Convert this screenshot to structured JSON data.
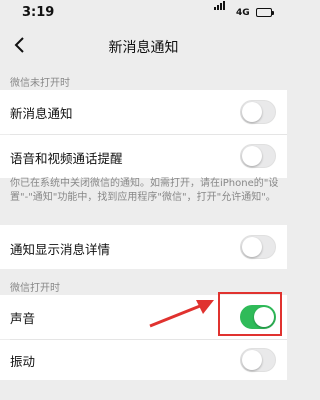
{
  "status_bar": {
    "time": "3:19",
    "network": "4G"
  },
  "nav": {
    "title": "新消息通知"
  },
  "sections": {
    "closed_header": "微信未打开时",
    "open_header": "微信打开时"
  },
  "rows": {
    "new_message": {
      "label": "新消息通知",
      "on": false
    },
    "voice_video": {
      "label": "语音和视频通话提醒",
      "on": false
    },
    "show_detail": {
      "label": "通知显示消息详情",
      "on": false
    },
    "sound": {
      "label": "声音",
      "on": true
    },
    "vibrate": {
      "label": "振动",
      "on": false
    }
  },
  "note": "你已在系统中关闭微信的通知。如需打开，请在iPhone的\"设置\"-\"通知\"功能中，找到应用程序\"微信\"，打开\"允许通知\"。",
  "colors": {
    "toggle_on": "#2fbb59",
    "annotation": "#e0322f"
  }
}
